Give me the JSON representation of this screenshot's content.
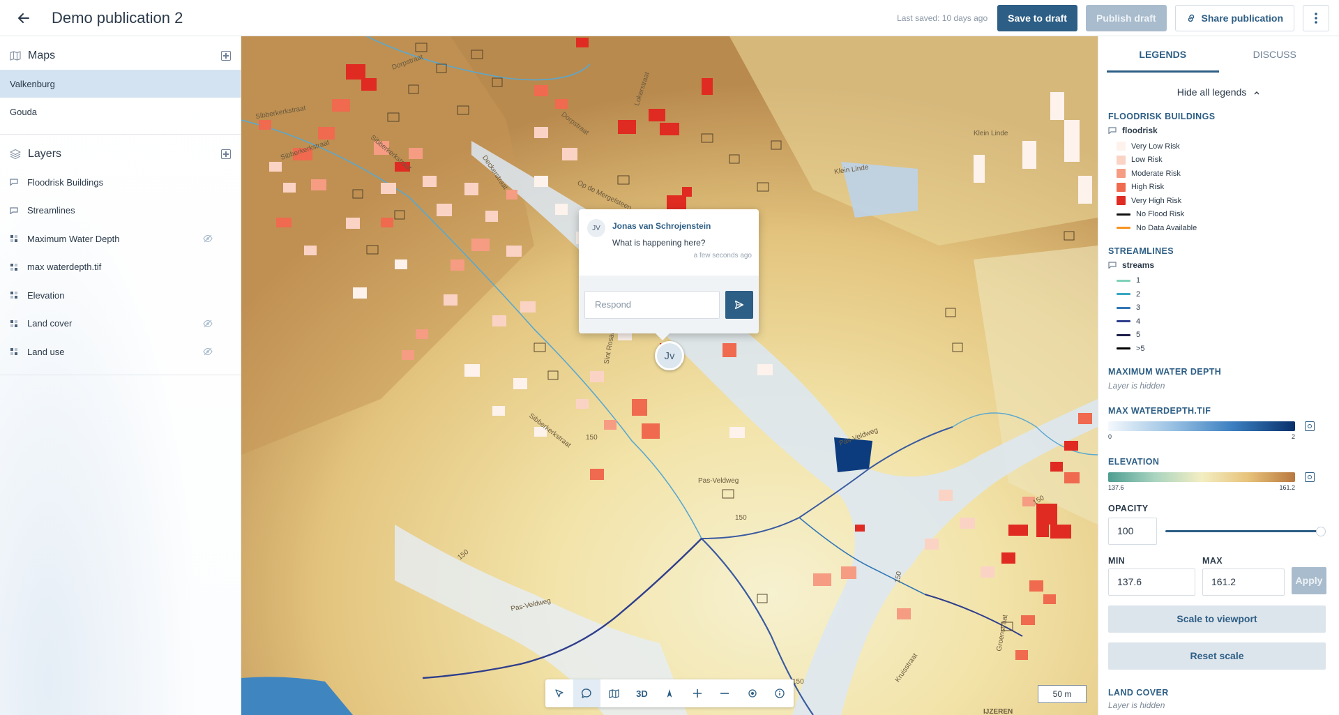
{
  "header": {
    "back_icon": "arrow-left-icon",
    "title": "Demo publication 2",
    "last_saved": "Last saved: 10 days ago",
    "save_label": "Save to draft",
    "publish_label": "Publish draft",
    "share_label": "Share publication",
    "share_icon": "link-icon",
    "more_icon": "kebab-icon"
  },
  "sidebar": {
    "maps_title": "Maps",
    "maps": [
      {
        "label": "Valkenburg",
        "selected": true
      },
      {
        "label": "Gouda",
        "selected": false
      }
    ],
    "layers_title": "Layers",
    "layers": [
      {
        "label": "Floodrisk Buildings",
        "icon": "comment-icon",
        "hidden": false
      },
      {
        "label": "Streamlines",
        "icon": "comment-icon",
        "hidden": false
      },
      {
        "label": "Maximum Water Depth",
        "icon": "raster-icon",
        "hidden": true
      },
      {
        "label": "max waterdepth.tif",
        "icon": "raster-icon",
        "hidden": false
      },
      {
        "label": "Elevation",
        "icon": "raster-icon",
        "hidden": false
      },
      {
        "label": "Land cover",
        "icon": "raster-icon",
        "hidden": true
      },
      {
        "label": "Land use",
        "icon": "raster-icon",
        "hidden": true
      }
    ]
  },
  "map": {
    "labels": [
      "Dorpstraat",
      "Lokerstraat",
      "Sibberkerkstraat",
      "Dorpstraat",
      "Sibberkerkstraat",
      "Deckerstraat",
      "Op de Mergelsteen",
      "Klein Linde",
      "Klein Linde",
      "Sibberkerkstraat",
      "Sint Rosalia",
      "Sibberkerkstraat",
      "Pas-Veldweg",
      "Pas-Veldweg",
      "Pas-Veldweg",
      "150",
      "150",
      "150",
      "150",
      "150",
      "150",
      "Groenstraat",
      "Kruisstraat",
      "IJZEREN"
    ],
    "comment": {
      "initials": "JV",
      "author": "Jonas van Schrojenstein",
      "text": "What is happening here?",
      "time": "a few seconds ago",
      "respond_placeholder": "Respond",
      "send_icon": "send-icon"
    },
    "pin_initials": "Jv",
    "toolbar": {
      "select_icon": "cursor-icon",
      "comment_icon": "comment-icon",
      "map_icon": "map-icon",
      "three_d_label": "3D",
      "north_icon": "compass-icon",
      "zoom_in_icon": "plus-icon",
      "zoom_out_icon": "minus-icon",
      "locate_icon": "target-icon",
      "info_icon": "info-icon"
    },
    "scale_label": "50 m"
  },
  "legends": {
    "tab_legends": "LEGENDS",
    "tab_discuss": "DISCUSS",
    "hide_all": "Hide all legends",
    "floodrisk_title": "FLOODRISK BUILDINGS",
    "floodrisk_sub": "floodrisk",
    "floodrisk_items": [
      {
        "label": "Very Low Risk",
        "color": "#fdf2ec",
        "kind": "swatch"
      },
      {
        "label": "Low Risk",
        "color": "#fbd3c5",
        "kind": "swatch"
      },
      {
        "label": "Moderate Risk",
        "color": "#f59c83",
        "kind": "swatch"
      },
      {
        "label": "High Risk",
        "color": "#ef6a4f",
        "kind": "swatch"
      },
      {
        "label": "Very High Risk",
        "color": "#e02b22",
        "kind": "swatch"
      },
      {
        "label": "No Flood Risk",
        "color": "#111111",
        "kind": "line"
      },
      {
        "label": "No Data Available",
        "color": "#f7931e",
        "kind": "line"
      }
    ],
    "streamlines_title": "STREAMLINES",
    "streamlines_sub": "streams",
    "stream_items": [
      {
        "label": "1",
        "color": "#7fd1b9"
      },
      {
        "label": "2",
        "color": "#3aa7c2"
      },
      {
        "label": "3",
        "color": "#3277b5"
      },
      {
        "label": "4",
        "color": "#2f3e8c"
      },
      {
        "label": "5",
        "color": "#1e1f4a"
      },
      {
        "label": ">5",
        "color": "#000000"
      }
    ],
    "mwd_title": "MAXIMUM WATER DEPTH",
    "mwd_hidden": "Layer is hidden",
    "tif_title": "MAX WATERDEPTH.TIF",
    "tif_min": "0",
    "tif_max": "2",
    "elev_title": "ELEVATION",
    "elev_min": "137.6",
    "elev_max": "161.2",
    "opacity_label": "OPACITY",
    "opacity_value": "100",
    "min_label": "MIN",
    "max_label": "MAX",
    "min_value": "137.6",
    "max_value": "161.2",
    "apply_label": "Apply",
    "scale_viewport_label": "Scale to viewport",
    "reset_scale_label": "Reset scale",
    "landcover_title": "LAND COVER",
    "landcover_hidden": "Layer is hidden"
  },
  "colors": {
    "accent": "#2d5e85",
    "selected_bg": "#d4e3f1",
    "disabled": "#a9bccd"
  }
}
